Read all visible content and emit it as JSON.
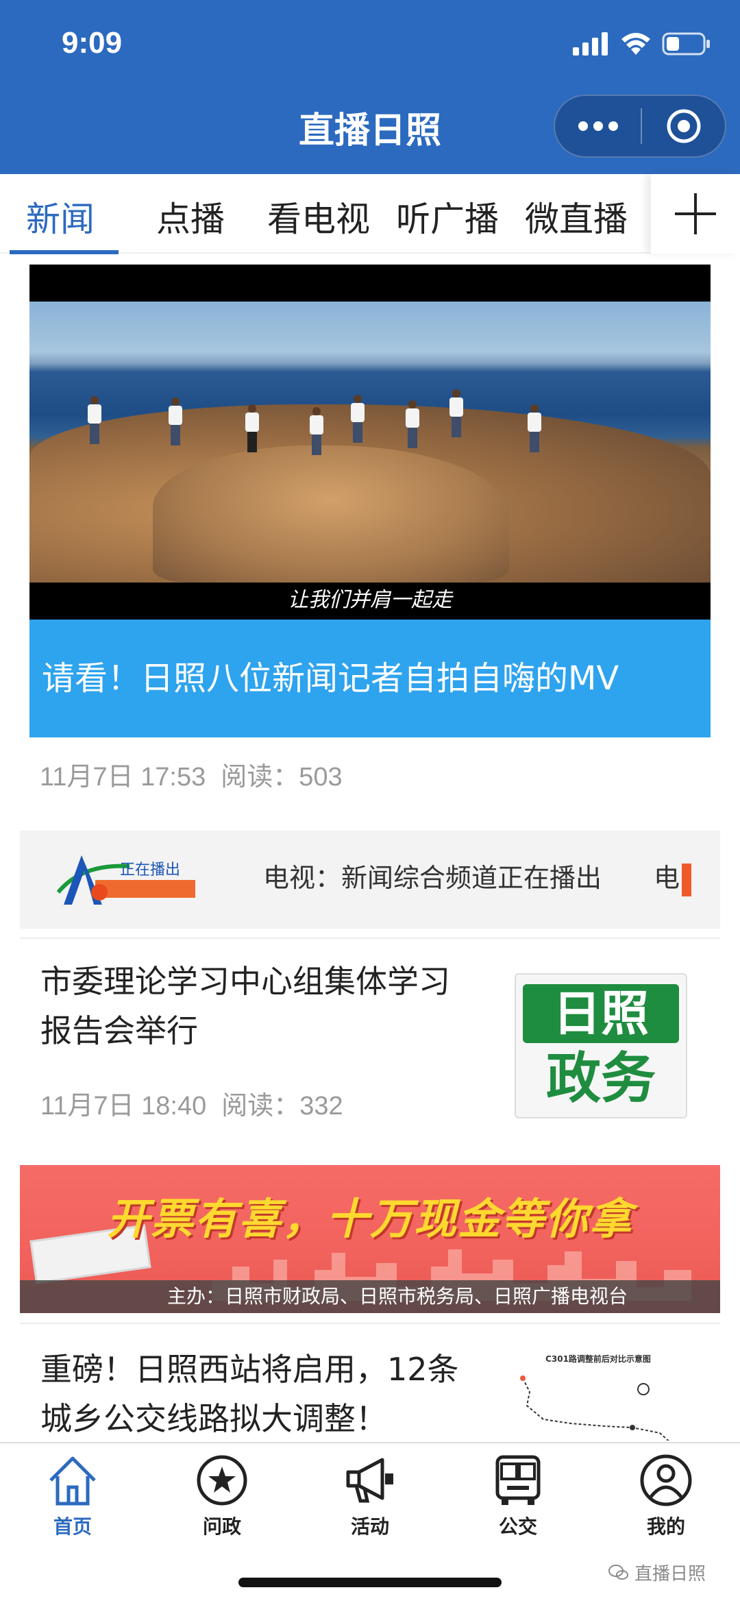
{
  "status_bar": {
    "time": "9:09"
  },
  "header": {
    "title": "直播日照",
    "accent": "#2c6abf"
  },
  "tabs": {
    "items": [
      {
        "label": "新闻",
        "active": true
      },
      {
        "label": "点播"
      },
      {
        "label": "看电视"
      },
      {
        "label": "听广播"
      },
      {
        "label": "微直播"
      }
    ]
  },
  "feature": {
    "video_subtitle": "让我们并肩一起走",
    "caption": "请看！日照八位新闻记者自拍自嗨的MV",
    "date": "11月7日 17:53",
    "reads": "阅读：503"
  },
  "live_banner": {
    "logo_label": "正在播出",
    "text": "电视：新闻综合频道正在播出",
    "tail": "电"
  },
  "news": [
    {
      "title": "市委理论学习中心组集体学习报告会举行",
      "date": "11月7日 18:40",
      "reads": "阅读：332",
      "thumb_top": "日照",
      "thumb_bottom": "政务"
    },
    {
      "title": "重磅！日照西站将启用，12条城乡公交线路拟大调整！",
      "thumb_caption": "C301路调整前后对比示意图"
    }
  ],
  "ad": {
    "headline": "开票有喜，十万现金等你拿",
    "footer": "主办：日照市财政局、日照市税务局、日照广播电视台"
  },
  "tabbar": {
    "items": [
      {
        "label": "首页",
        "icon": "home-icon",
        "active": true
      },
      {
        "label": "问政",
        "icon": "star-icon"
      },
      {
        "label": "活动",
        "icon": "megaphone-icon"
      },
      {
        "label": "公交",
        "icon": "bus-icon"
      },
      {
        "label": "我的",
        "icon": "user-icon"
      }
    ]
  },
  "watermark": "直播日照"
}
